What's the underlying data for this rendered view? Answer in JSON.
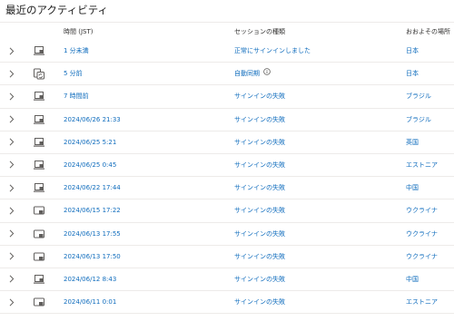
{
  "section": {
    "title": "最近のアクティビティ"
  },
  "columns": {
    "time": "時間 (JST)",
    "session": "セッションの種類",
    "location": "おおよその場所"
  },
  "rows": [
    {
      "device": "laptop",
      "time": "1 分未満",
      "session": "正常にサインインしました",
      "location": "日本",
      "info": false
    },
    {
      "device": "sync",
      "time": "5 分前",
      "session": "自動同期",
      "location": "日本",
      "info": true
    },
    {
      "device": "laptop",
      "time": "7 時間前",
      "session": "サインインの失敗",
      "location": "ブラジル",
      "info": false
    },
    {
      "device": "laptop",
      "time": "2024/06/26 21:33",
      "session": "サインインの失敗",
      "location": "ブラジル",
      "info": false
    },
    {
      "device": "laptop",
      "time": "2024/06/25 5:21",
      "session": "サインインの失敗",
      "location": "英国",
      "info": false
    },
    {
      "device": "laptop",
      "time": "2024/06/25 0:45",
      "session": "サインインの失敗",
      "location": "エストニア",
      "info": false
    },
    {
      "device": "laptop",
      "time": "2024/06/22 17:44",
      "session": "サインインの失敗",
      "location": "中国",
      "info": false
    },
    {
      "device": "tablet",
      "time": "2024/06/15 17:22",
      "session": "サインインの失敗",
      "location": "ウクライナ",
      "info": false
    },
    {
      "device": "tablet",
      "time": "2024/06/13 17:55",
      "session": "サインインの失敗",
      "location": "ウクライナ",
      "info": false
    },
    {
      "device": "tablet",
      "time": "2024/06/13 17:50",
      "session": "サインインの失敗",
      "location": "ウクライナ",
      "info": false
    },
    {
      "device": "laptop",
      "time": "2024/06/12 8:43",
      "session": "サインインの失敗",
      "location": "中国",
      "info": false
    },
    {
      "device": "tablet",
      "time": "2024/06/11 0:01",
      "session": "サインインの失敗",
      "location": "エストニア",
      "info": false
    }
  ],
  "colors": {
    "link": "#0f6cbd",
    "text": "#1b1b1b",
    "divider": "#edebe9",
    "icon": "#605e5c"
  }
}
